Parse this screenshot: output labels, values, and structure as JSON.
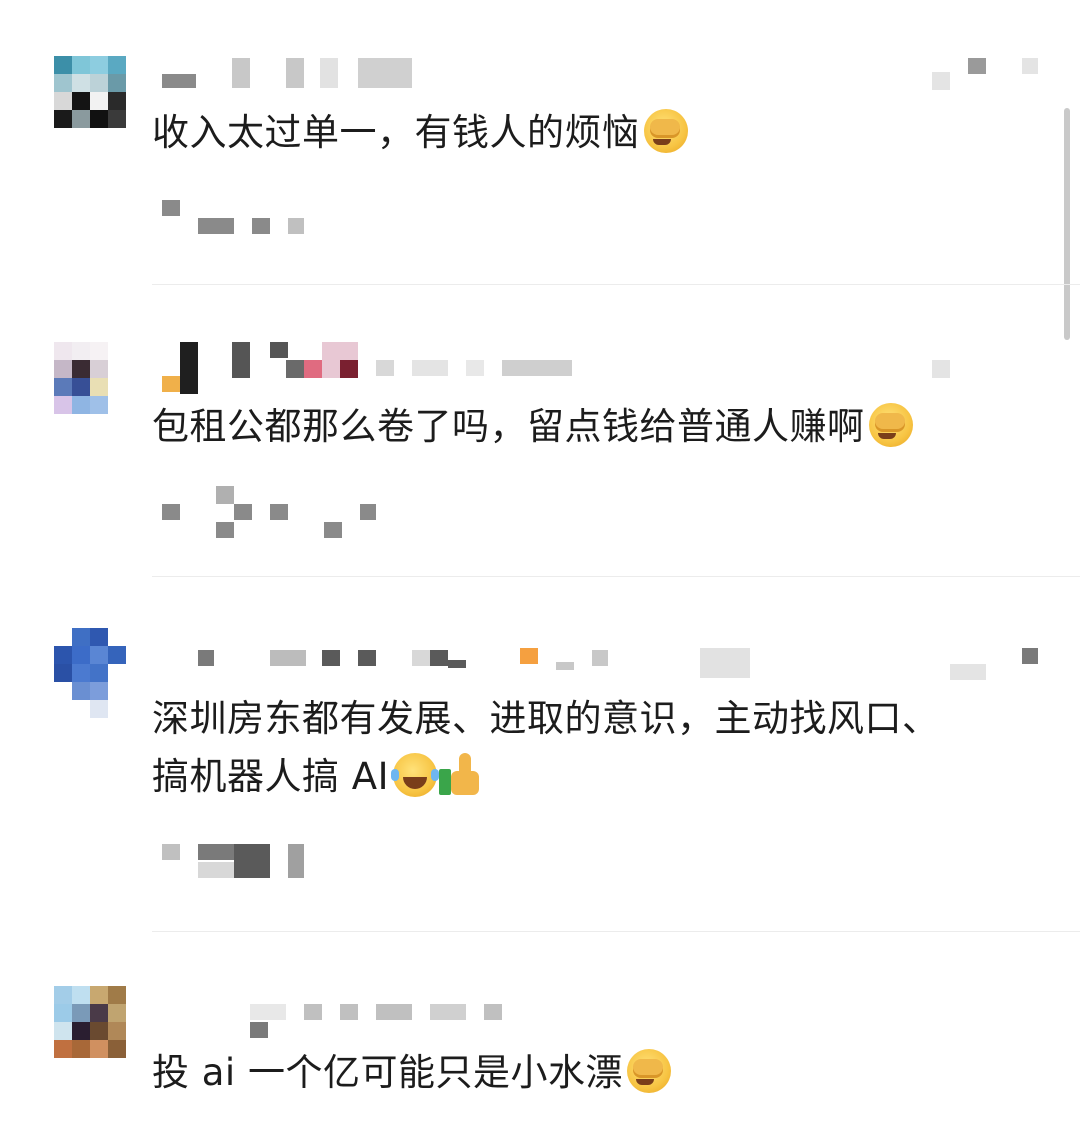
{
  "comments": [
    {
      "text": "收入太过单一，有钱人的烦恼",
      "emoji": [
        "facepalm-emoji"
      ]
    },
    {
      "text": "包租公都那么卷了吗，留点钱给普通人赚啊",
      "emoji": [
        "facepalm-emoji"
      ]
    },
    {
      "text_line1": "深圳房东都有发展、进取的意识，主动找风口、",
      "text_line2": "搞机器人搞 AI",
      "emoji": [
        "tears-of-joy-emoji",
        "thumbs-up-emoji"
      ]
    },
    {
      "text": "投 ai 一个亿可能只是小水漂",
      "emoji": [
        "facepalm-emoji"
      ]
    }
  ],
  "colors": {
    "text": "#1c1c1c",
    "pixelated_gray": "#8a8a8a",
    "divider": "#ececec",
    "background": "#ffffff"
  },
  "icons": [
    "facepalm-emoji",
    "tears-of-joy-emoji",
    "thumbs-up-emoji"
  ]
}
